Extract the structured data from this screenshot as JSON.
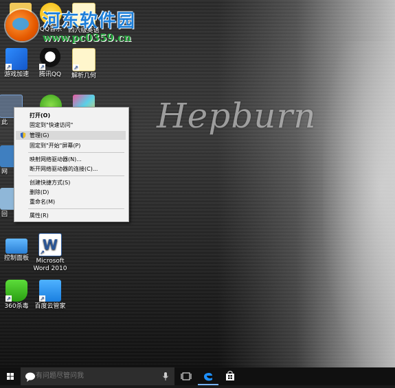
{
  "watermark": {
    "site_name": "河东软件园",
    "url": "www.pc0359.cn"
  },
  "wallpaper": {
    "text": "Hepburn"
  },
  "desktop_icons": [
    {
      "label": ""
    },
    {
      "label": "QQ音乐"
    },
    {
      "label": "四六级英语"
    },
    {
      "label": "游戏加速"
    },
    {
      "label": "腾讯QQ"
    },
    {
      "label": "解析几何"
    },
    {
      "label": "此"
    },
    {
      "label": "网"
    },
    {
      "label": "回"
    },
    {
      "label": "控制面板"
    },
    {
      "label": "Microsoft Word 2010"
    },
    {
      "label": "360杀毒"
    },
    {
      "label": "百度云管家"
    }
  ],
  "context_menu": {
    "items": [
      {
        "label": "打开(O)"
      },
      {
        "label": "固定到\"快速访问\""
      },
      {
        "label": "管理(G)"
      },
      {
        "label": "固定到\"开始\"屏幕(P)"
      },
      {
        "label": "映射网络驱动器(N)..."
      },
      {
        "label": "断开网络驱动器的连接(C)..."
      },
      {
        "label": "创建快捷方式(S)"
      },
      {
        "label": "删除(D)"
      },
      {
        "label": "重命名(M)"
      },
      {
        "label": "属性(R)"
      }
    ]
  },
  "taskbar": {
    "search_placeholder": "有问题尽管问我"
  },
  "colors": {
    "taskbar": "#101010",
    "menu_bg": "#f2f2f2",
    "menu_highlight": "#d9d9d9",
    "edge_blue": "#1e90ff"
  }
}
